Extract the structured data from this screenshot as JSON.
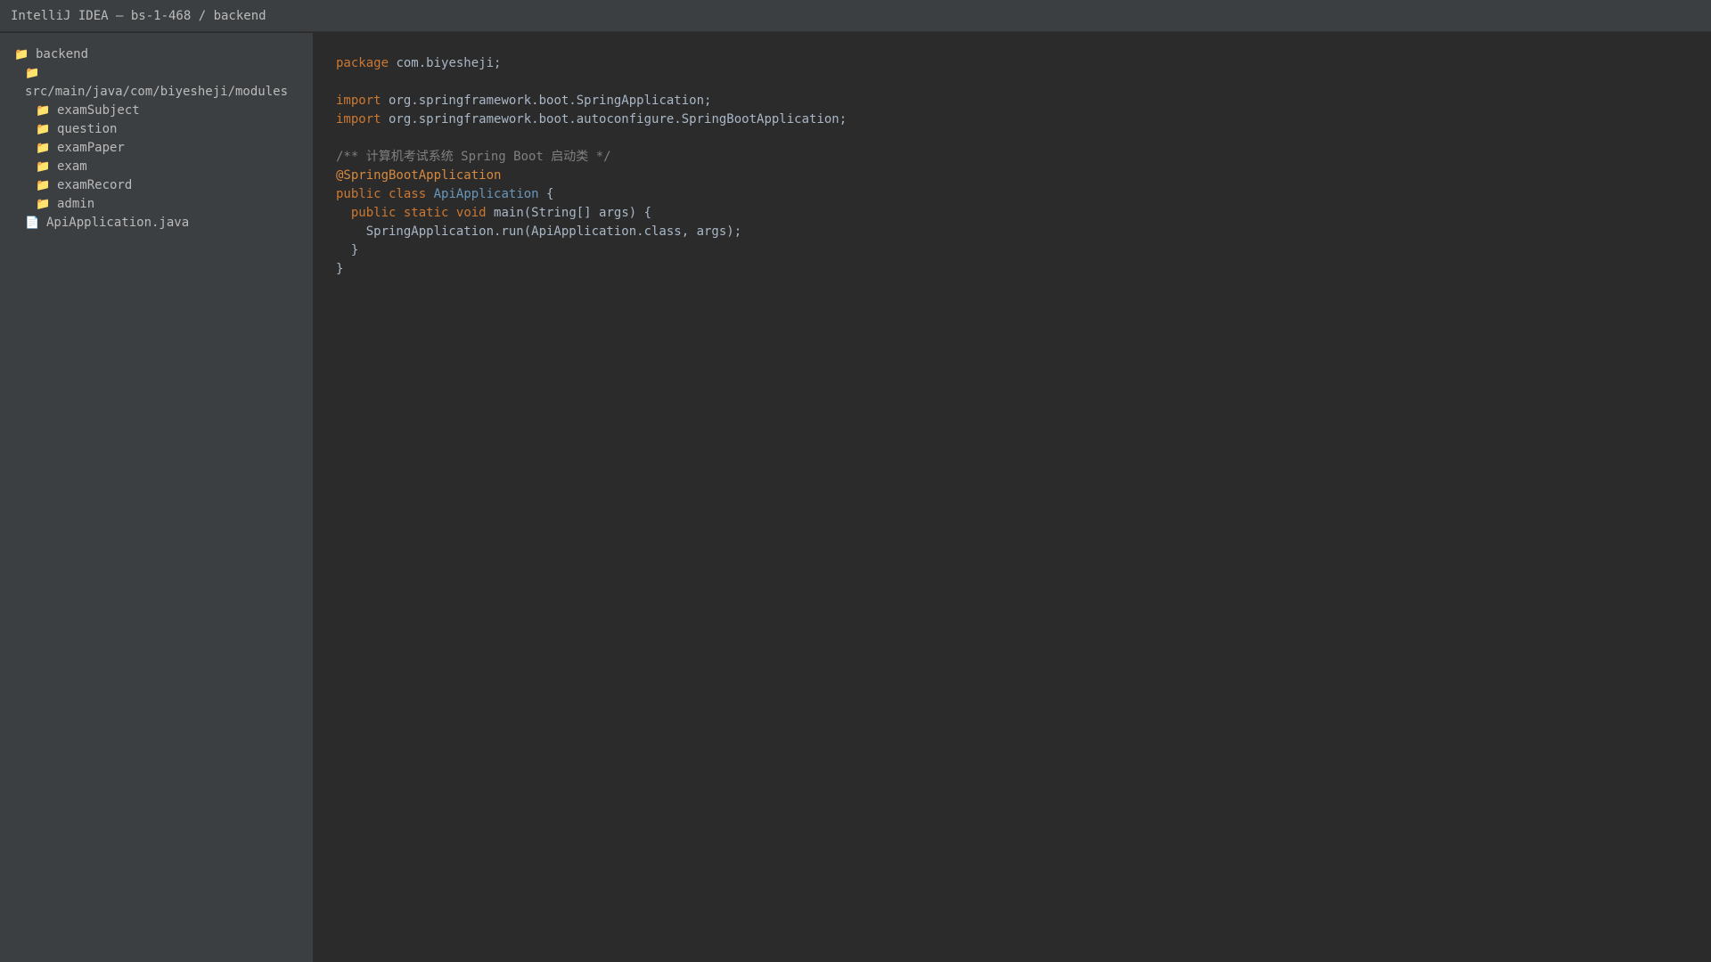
{
  "window": {
    "title": "IntelliJ IDEA — bs-1-468 / backend"
  },
  "sidebar": {
    "items": [
      {
        "icon": "folder-icon",
        "label": "backend"
      },
      {
        "icon": "folder-icon",
        "label": "src/main/java/com/biyesheji/modules"
      },
      {
        "icon": "folder-icon",
        "label": "examSubject"
      },
      {
        "icon": "folder-icon",
        "label": "question"
      },
      {
        "icon": "folder-icon",
        "label": "examPaper"
      },
      {
        "icon": "folder-icon",
        "label": "exam"
      },
      {
        "icon": "folder-icon",
        "label": "examRecord"
      },
      {
        "icon": "folder-icon",
        "label": "admin"
      },
      {
        "icon": "file-icon",
        "label": "ApiApplication.java"
      }
    ]
  },
  "editor": {
    "lines": {
      "l1": {
        "kw": "package",
        "rest": " com.biyesheji;"
      },
      "l3": {
        "kw": "import",
        "rest": " org.springframework.boot.SpringApplication;"
      },
      "l4": {
        "kw": "import",
        "rest": " org.springframework.boot.autoconfigure.SpringBootApplication;"
      },
      "l6": {
        "comment": "/** 计算机考试系统 Spring Boot 启动类 */"
      },
      "l7": {
        "annotation": "@SpringBootApplication"
      },
      "l8": {
        "kw1": "public",
        "kw2": "class",
        "cls": "ApiApplication",
        "rest": " {"
      },
      "l9": {
        "indent": "  ",
        "kw1": "public",
        "kw2": "static",
        "kw3": "void",
        "rest": " main(String[] args) {"
      },
      "l10": {
        "text": "    SpringApplication.run(ApiApplication.class, args);"
      },
      "l11": {
        "text": "  }"
      },
      "l12": {
        "text": "}"
      }
    }
  },
  "colors": {
    "background": "#2b2b2b",
    "panel": "#3c3f41",
    "keyword": "#cc7832",
    "class_name": "#6897bb",
    "comment": "#808080",
    "text": "#a9b7c6",
    "folder": "#e6b450"
  }
}
